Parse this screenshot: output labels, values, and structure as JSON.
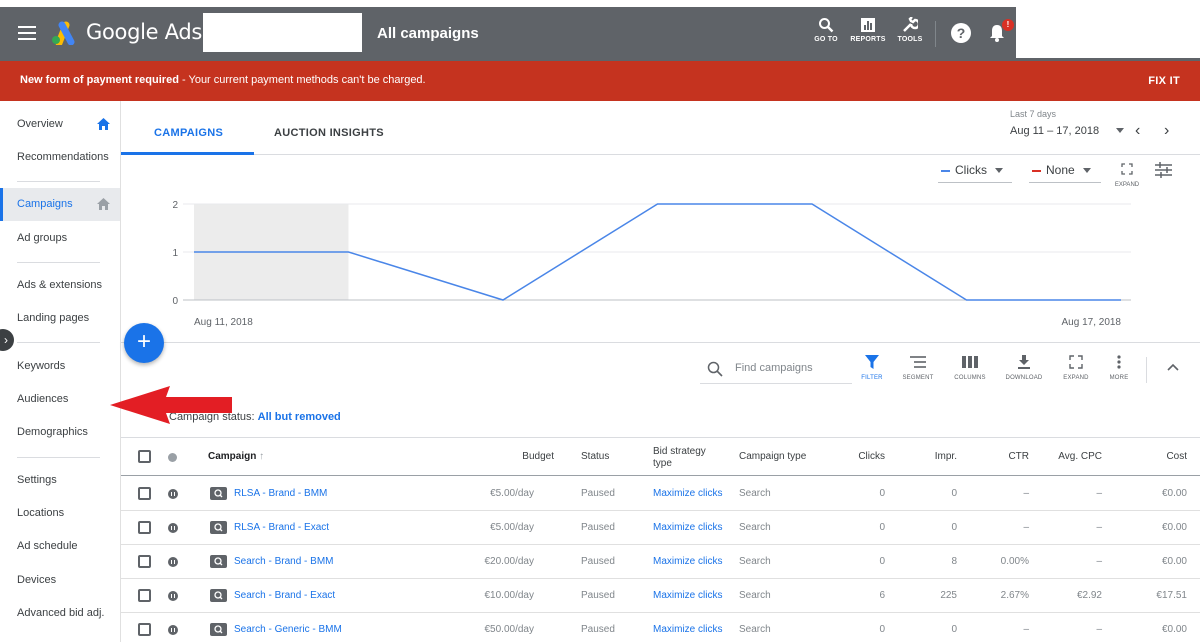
{
  "header": {
    "brand": "Google Ads",
    "page_title": "All campaigns",
    "tools": [
      {
        "label": "GO TO",
        "icon": "search-icon"
      },
      {
        "label": "REPORTS",
        "icon": "reports-icon"
      },
      {
        "label": "TOOLS",
        "icon": "wrench-icon"
      }
    ],
    "help_icon_glyph": "?",
    "notification_badge": "!"
  },
  "alert": {
    "bold": "New form of payment required",
    "message": " - Your current payment methods can't be charged.",
    "action": "FIX IT",
    "color": "#c5331f"
  },
  "sidebar": {
    "items": [
      {
        "label": "Overview"
      },
      {
        "label": "Recommendations"
      },
      {
        "label": "Campaigns"
      },
      {
        "label": "Ad groups"
      },
      {
        "label": "Ads & extensions"
      },
      {
        "label": "Landing pages"
      },
      {
        "label": "Keywords"
      },
      {
        "label": "Audiences"
      },
      {
        "label": "Demographics"
      },
      {
        "label": "Settings"
      },
      {
        "label": "Locations"
      },
      {
        "label": "Ad schedule"
      },
      {
        "label": "Devices"
      },
      {
        "label": "Advanced bid adj."
      }
    ],
    "active": "Campaigns",
    "accent": "#1a73e8"
  },
  "tabs": [
    {
      "label": "CAMPAIGNS",
      "active": true
    },
    {
      "label": "AUCTION INSIGHTS",
      "active": false
    }
  ],
  "date_range": {
    "label": "Last 7 days",
    "value": "Aug 11 – 17, 2018"
  },
  "chart_controls": {
    "metric1": "Clicks",
    "metric1_color": "#4a86e8",
    "metric2": "None",
    "metric2_color": "#d93025",
    "expand_label": "EXPAND"
  },
  "chart_data": {
    "type": "line",
    "x": [
      "Aug 11, 2018",
      "Aug 12, 2018",
      "Aug 13, 2018",
      "Aug 14, 2018",
      "Aug 15, 2018",
      "Aug 16, 2018",
      "Aug 17, 2018"
    ],
    "x_tick_labels": [
      "Aug 11, 2018",
      "Aug 17, 2018"
    ],
    "series": [
      {
        "name": "Clicks",
        "values": [
          1,
          1,
          0,
          2,
          2,
          0,
          0
        ],
        "color": "#4a86e8"
      }
    ],
    "y_ticks": [
      0,
      1,
      2
    ],
    "ylim": [
      0,
      2
    ],
    "grid": true,
    "highlighted_range": [
      "Aug 11, 2018",
      "Aug 12, 2018"
    ]
  },
  "toolbar": {
    "search_placeholder": "Find campaigns",
    "tools": [
      {
        "label": "FILTER",
        "icon": "filter-icon",
        "active": true
      },
      {
        "label": "SEGMENT",
        "icon": "segment-icon",
        "active": false
      },
      {
        "label": "COLUMNS",
        "icon": "columns-icon",
        "active": false
      },
      {
        "label": "DOWNLOAD",
        "icon": "download-icon",
        "active": false
      },
      {
        "label": "EXPAND",
        "icon": "expand-icon",
        "active": false
      },
      {
        "label": "MORE",
        "icon": "more-icon",
        "active": false
      }
    ]
  },
  "filter": {
    "label": "Campaign status: ",
    "value": "All but removed"
  },
  "table": {
    "columns": [
      "Campaign",
      "Budget",
      "Status",
      "Bid strategy type",
      "Campaign type",
      "Clicks",
      "Impr.",
      "CTR",
      "Avg. CPC",
      "Cost"
    ],
    "bid_strategy_lines": [
      "Bid strategy",
      "type"
    ],
    "rows": [
      {
        "campaign": "RLSA - Brand - BMM",
        "budget": "€5.00/day",
        "status": "Paused",
        "bid_strategy": "Maximize clicks",
        "campaign_type": "Search",
        "clicks": "0",
        "impr": "0",
        "ctr": "–",
        "avg_cpc": "–",
        "cost": "€0.00"
      },
      {
        "campaign": "RLSA - Brand - Exact",
        "budget": "€5.00/day",
        "status": "Paused",
        "bid_strategy": "Maximize clicks",
        "campaign_type": "Search",
        "clicks": "0",
        "impr": "0",
        "ctr": "–",
        "avg_cpc": "–",
        "cost": "€0.00"
      },
      {
        "campaign": "Search - Brand - BMM",
        "budget": "€20.00/day",
        "status": "Paused",
        "bid_strategy": "Maximize clicks",
        "campaign_type": "Search",
        "clicks": "0",
        "impr": "8",
        "ctr": "0.00%",
        "avg_cpc": "–",
        "cost": "€0.00"
      },
      {
        "campaign": "Search - Brand - Exact",
        "budget": "€10.00/day",
        "status": "Paused",
        "bid_strategy": "Maximize clicks",
        "campaign_type": "Search",
        "clicks": "6",
        "impr": "225",
        "ctr": "2.67%",
        "avg_cpc": "€2.92",
        "cost": "€17.51"
      },
      {
        "campaign": "Search - Generic - BMM",
        "budget": "€50.00/day",
        "status": "Paused",
        "bid_strategy": "Maximize clicks",
        "campaign_type": "Search",
        "clicks": "0",
        "impr": "0",
        "ctr": "–",
        "avg_cpc": "–",
        "cost": "€0.00"
      }
    ]
  },
  "overlay": {
    "annotation_arrow_color": "#e31e24"
  }
}
